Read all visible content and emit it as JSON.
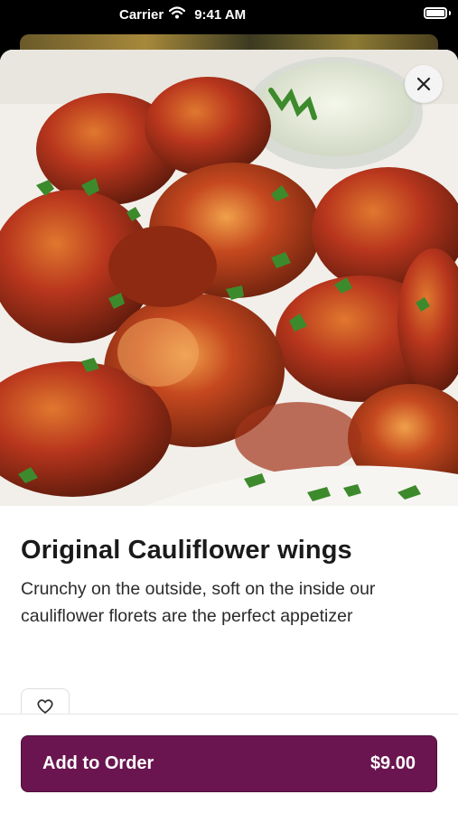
{
  "status_bar": {
    "carrier": "Carrier",
    "time": "9:41 AM"
  },
  "item": {
    "name": "Original Cauliflower wings",
    "description": "Crunchy on the outside, soft on the inside our cauliflower florets are the perfect appetizer",
    "image_icon": "cauliflower-wings-photo"
  },
  "actions": {
    "close_icon": "close-icon",
    "favorite_icon": "heart-outline-icon",
    "add_label": "Add to Order",
    "price": "$9.00"
  },
  "colors": {
    "accent": "#6a1550",
    "sauce": "#b8361d",
    "garnish": "#3d8a2c"
  }
}
